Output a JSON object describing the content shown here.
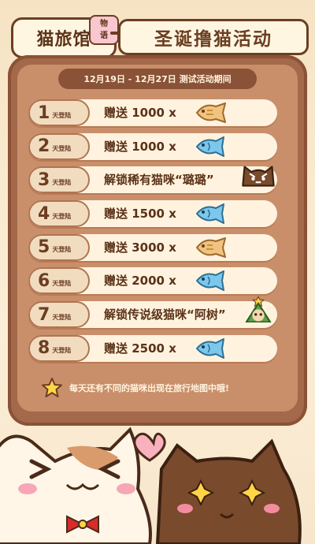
{
  "header": {
    "logo_text": "猫旅馆",
    "logo_sub": "物\n语",
    "title": "圣诞撸猫活动"
  },
  "event": {
    "date_range": "12月19日 - 12月27日 测试活动期间"
  },
  "day_suffix": "天登陆",
  "rows": [
    {
      "day": "1",
      "reward": "赠送 1000 x",
      "icon": "taiyaki-icon"
    },
    {
      "day": "2",
      "reward": "赠送 1000 x",
      "icon": "fish-icon"
    },
    {
      "day": "3",
      "reward": "解锁稀有猫咪“璐璐”",
      "icon": "brown-cat-icon"
    },
    {
      "day": "4",
      "reward": "赠送 1500 x",
      "icon": "fish-icon"
    },
    {
      "day": "5",
      "reward": "赠送 3000 x",
      "icon": "taiyaki-icon"
    },
    {
      "day": "6",
      "reward": "赠送 2000 x",
      "icon": "fish-icon"
    },
    {
      "day": "7",
      "reward": "解锁传说级猫咪“阿树”",
      "icon": "tree-cat-icon"
    },
    {
      "day": "8",
      "reward": "赠送 2500 x",
      "icon": "fish-icon"
    }
  ],
  "footer_note": "每天还有不同的猫咪出现在旅行地图中哦!",
  "colors": {
    "frame": "#a4684a",
    "board": "#c98f6a",
    "row_bg": "#fff3df",
    "text_brown": "#5b3218"
  }
}
